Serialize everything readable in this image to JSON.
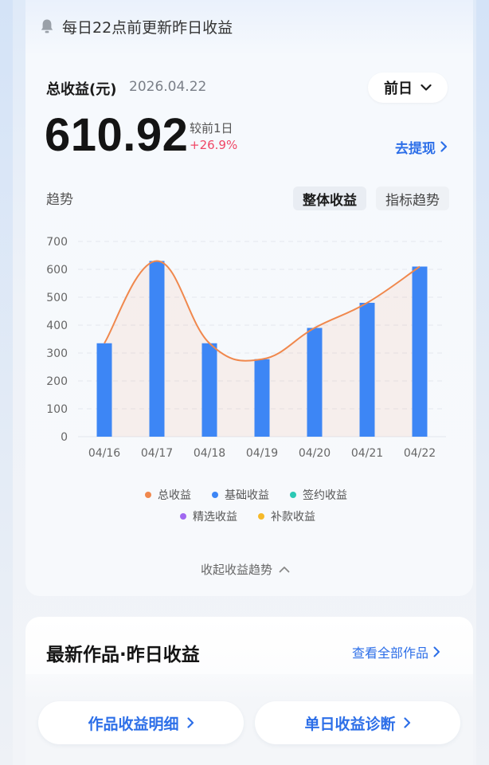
{
  "notice": {
    "text": "每日22点前更新昨日收益",
    "icon": "bell-icon"
  },
  "summary": {
    "label": "总收益(元)",
    "date": "2026.04.22",
    "value": "610.92",
    "compare_label": "较前1日",
    "compare_value": "+26.9%",
    "range_selected": "前日",
    "withdraw_label": "去提现"
  },
  "trend": {
    "label": "趋势",
    "tabs": [
      {
        "label": "整体收益",
        "active": true
      },
      {
        "label": "指标趋势",
        "active": false
      }
    ],
    "collapse_label": "收起收益趋势"
  },
  "colors": {
    "accent": "#2d6fe8",
    "bar": "#3d86f5",
    "line": "#f0884d",
    "up": "#f04766"
  },
  "chart_data": {
    "type": "bar",
    "categories": [
      "04/16",
      "04/17",
      "04/18",
      "04/19",
      "04/20",
      "04/21",
      "04/22"
    ],
    "ylim": [
      0,
      700
    ],
    "yticks": [
      0,
      100,
      200,
      300,
      400,
      500,
      600,
      700
    ],
    "grid": true,
    "legend_position": "bottom",
    "series": [
      {
        "name": "总收益",
        "type": "line",
        "color": "#f0884d",
        "values": [
          335,
          630,
          335,
          278,
          390,
          480,
          610
        ]
      },
      {
        "name": "基础收益",
        "type": "bar",
        "color": "#3d86f5",
        "values": [
          335,
          630,
          335,
          278,
          390,
          480,
          610
        ]
      },
      {
        "name": "签约收益",
        "type": "bar",
        "color": "#2cc8b4",
        "values": []
      },
      {
        "name": "精选收益",
        "type": "bar",
        "color": "#a068f0",
        "values": []
      },
      {
        "name": "补款收益",
        "type": "bar",
        "color": "#f6b929",
        "values": []
      }
    ]
  },
  "works": {
    "title": "最新作品·昨日收益",
    "view_all_label": "查看全部作品"
  },
  "bottom": {
    "left_label": "作品收益明细",
    "right_label": "单日收益诊断"
  }
}
